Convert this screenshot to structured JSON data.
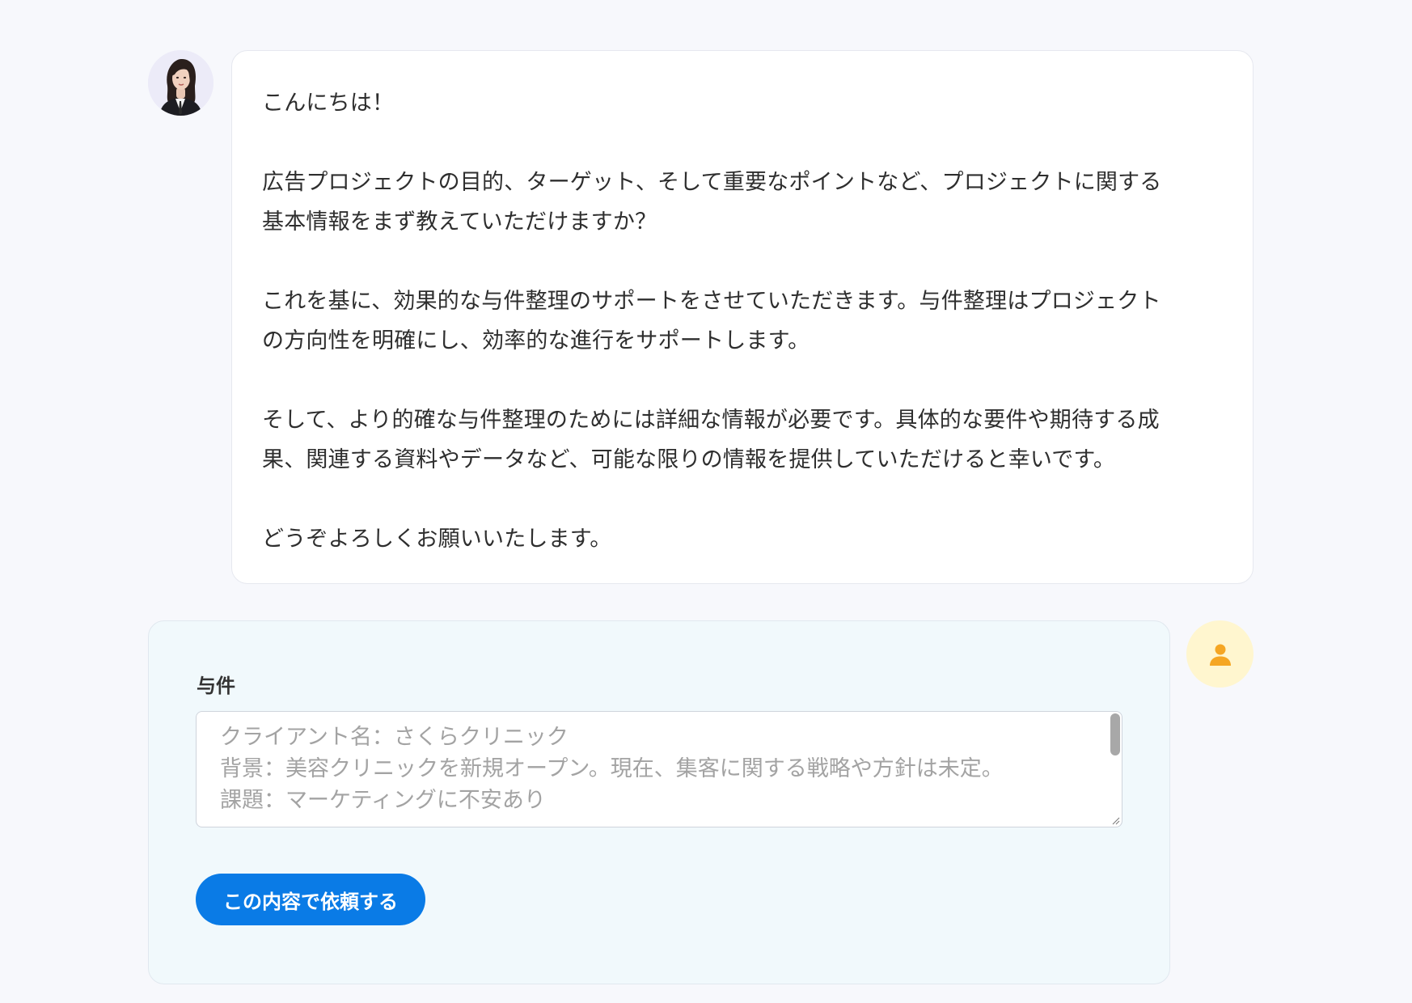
{
  "assistant": {
    "avatar_icon": "assistant-portrait-avatar",
    "message_lines": [
      "こんにちは！",
      "",
      "広告プロジェクトの目的、ターゲット、そして重要なポイントなど、プロジェクトに関する",
      "基本情報をまず教えていただけますか？",
      "",
      "これを基に、効果的な与件整理のサポートをさせていただきます。与件整理はプロジェクト",
      "の方向性を明確にし、効率的な進行をサポートします。",
      "",
      "そして、より的確な与件整理のためには詳細な情報が必要です。具体的な要件や期待する成",
      "果、関連する資料やデータなど、可能な限りの情報を提供していただけると幸いです。",
      "",
      "どうぞよろしくお願いいたします。"
    ]
  },
  "user": {
    "avatar_icon": "person-icon",
    "avatar_color": "#f5a623"
  },
  "form": {
    "field_label": "与件",
    "placeholder_lines": [
      "クライアント名：さくらクリニック",
      "背景：美容クリニックを新規オープン。現在、集客に関する戦略や方針は未定。",
      "課題：マーケティングに不安あり"
    ],
    "submit_label": "この内容で依頼する"
  },
  "colors": {
    "page_background": "#f7f8fc",
    "primary_button": "#0a7be6",
    "form_background": "#f1f9fc",
    "user_avatar_background": "#fff6cf"
  }
}
